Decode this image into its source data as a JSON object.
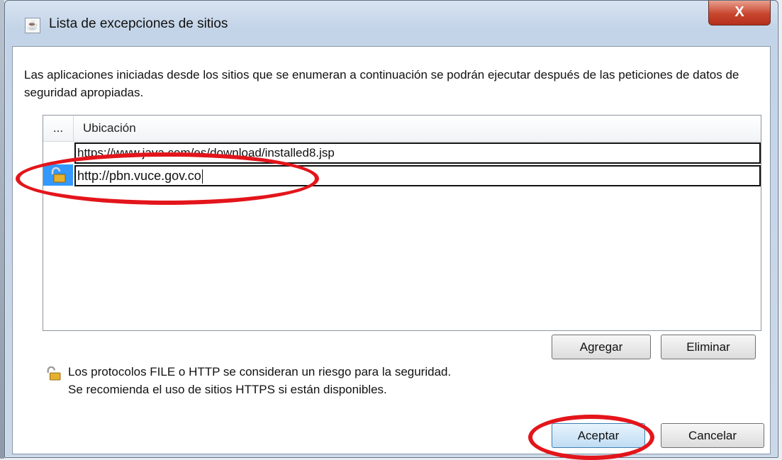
{
  "window": {
    "title": "Lista de excepciones de sitios",
    "close_label": "X"
  },
  "description": "Las aplicaciones iniciadas desde los sitios que se enumeran a continuación se podrán ejecutar después de las peticiones de datos de seguridad apropiadas.",
  "table": {
    "headers": {
      "icon_col": "...",
      "location_col": "Ubicación"
    },
    "rows": [
      {
        "location": "https://www.java.com/es/download/installed8.jsp",
        "insecure": false,
        "selected": false
      },
      {
        "location": "http://pbn.vuce.gov.co",
        "insecure": true,
        "selected": true
      }
    ]
  },
  "buttons": {
    "add": "Agregar",
    "remove": "Eliminar",
    "ok": "Aceptar",
    "cancel": "Cancelar"
  },
  "warning": {
    "line1": "Los protocolos FILE o HTTP se consideran un riesgo para la seguridad.",
    "line2": "Se recomienda el uso de sitios HTTPS si están disponibles.",
    "icon": "unlocked-padlock-icon"
  },
  "colors": {
    "selection": "#3399ff",
    "annotation": "#e3151b",
    "close_button": "#c8452e"
  }
}
